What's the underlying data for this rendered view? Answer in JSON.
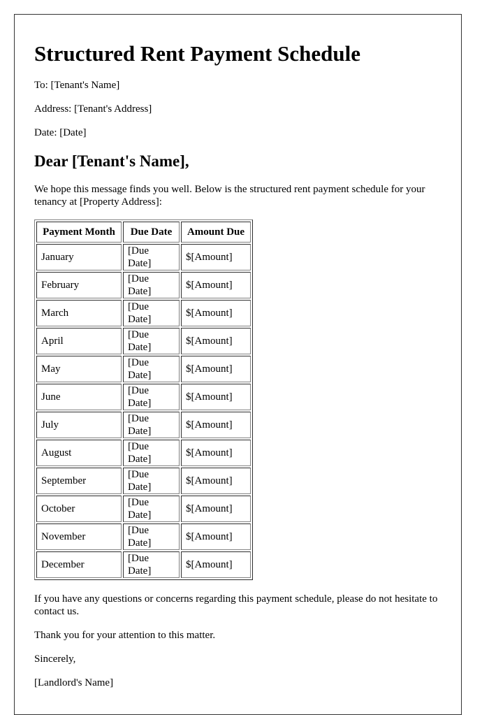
{
  "document": {
    "title": "Structured Rent Payment Schedule",
    "to_line": "To: [Tenant's Name]",
    "address_line": "Address: [Tenant's Address]",
    "date_line": "Date: [Date]",
    "salutation": "Dear [Tenant's Name],",
    "intro": "We hope this message finds you well. Below is the structured rent payment schedule for your tenancy at [Property Address]:",
    "questions": "If you have any questions or concerns regarding this payment schedule, please do not hesitate to contact us.",
    "thanks": "Thank you for your attention to this matter.",
    "closing": "Sincerely,",
    "signature": "[Landlord's Name]"
  },
  "schedule": {
    "headers": [
      "Payment Month",
      "Due Date",
      "Amount Due"
    ],
    "rows": [
      [
        "January",
        "[Due Date]",
        "$[Amount]"
      ],
      [
        "February",
        "[Due Date]",
        "$[Amount]"
      ],
      [
        "March",
        "[Due Date]",
        "$[Amount]"
      ],
      [
        "April",
        "[Due Date]",
        "$[Amount]"
      ],
      [
        "May",
        "[Due Date]",
        "$[Amount]"
      ],
      [
        "June",
        "[Due Date]",
        "$[Amount]"
      ],
      [
        "July",
        "[Due Date]",
        "$[Amount]"
      ],
      [
        "August",
        "[Due Date]",
        "$[Amount]"
      ],
      [
        "September",
        "[Due Date]",
        "$[Amount]"
      ],
      [
        "October",
        "[Due Date]",
        "$[Amount]"
      ],
      [
        "November",
        "[Due Date]",
        "$[Amount]"
      ],
      [
        "December",
        "[Due Date]",
        "$[Amount]"
      ]
    ]
  }
}
